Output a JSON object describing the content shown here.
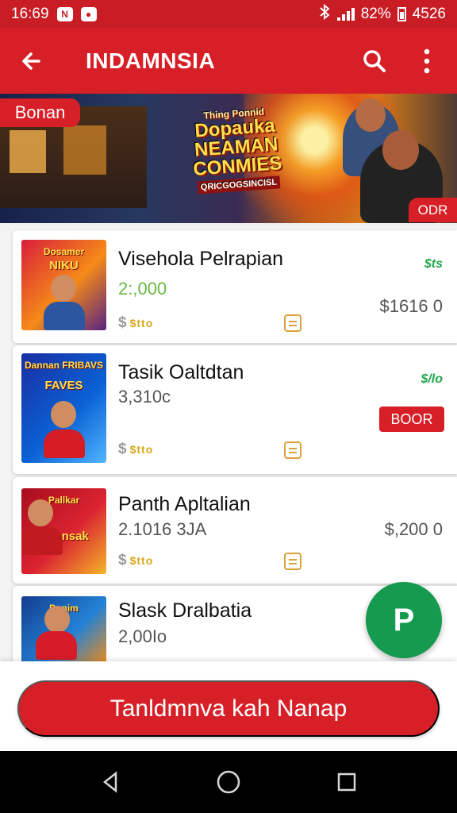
{
  "status_bar": {
    "time": "16:69",
    "notification_n": "N",
    "notification_dot": "●",
    "battery": "82%",
    "extra": "4526"
  },
  "app_bar": {
    "title": "INDAMNSIA",
    "icons": [
      "back-arrow-icon",
      "search-icon",
      "more-vert-icon"
    ]
  },
  "banner": {
    "left_tag": "Bonan",
    "logo_small": "Thing Ponnid",
    "logo_main_1": "Dopauka",
    "logo_main_2": "NEAMAN",
    "logo_main_3": "CONMIES",
    "logo_sub": "QRICGOGSINCISL",
    "right_tag": "ODR"
  },
  "items": [
    {
      "title": "Visehola Pelrapian",
      "subvalue": "2:,000",
      "subvalue_color": "#69b845",
      "price": "$1616 0",
      "meta_prefix": "$",
      "meta_text": "$tto",
      "green_note": "$ts",
      "thumb_t1": "Dosamer",
      "thumb_t2": "NIKU",
      "theme": "#e24d12"
    },
    {
      "title": "Tasik Oaltdtan",
      "subvalue": "3,310c",
      "subvalue_color": "#555555",
      "badge": "BOOR",
      "meta_prefix": "$",
      "meta_text": "$tto",
      "green_note": "$/lo",
      "thumb_t1": "Dannan FRIBAVS",
      "thumb_t2": "FAVES",
      "theme": "#214aa7"
    },
    {
      "title": "Panth Apltalian",
      "subvalue": "2.1016 3JA",
      "subvalue_color": "#555555",
      "price": "$,200 0",
      "meta_prefix": "$",
      "meta_text": "$tto",
      "thumb_t1": "Pallkar",
      "thumb_t2": "Haunsak",
      "theme": "#9e1220"
    },
    {
      "title": "Slask Dralbatia",
      "subvalue": "2,00Io",
      "subvalue_color": "#555555",
      "thumb_t1": "Denim",
      "thumb_t2": "",
      "theme": "#2563b2"
    }
  ],
  "fab": {
    "label": "P"
  },
  "cta": {
    "label": "Tanldmnva kah  Nanap"
  },
  "colors": {
    "primary": "#d71f27",
    "fab": "#159a4f",
    "accent_gold": "#d8a71b"
  }
}
